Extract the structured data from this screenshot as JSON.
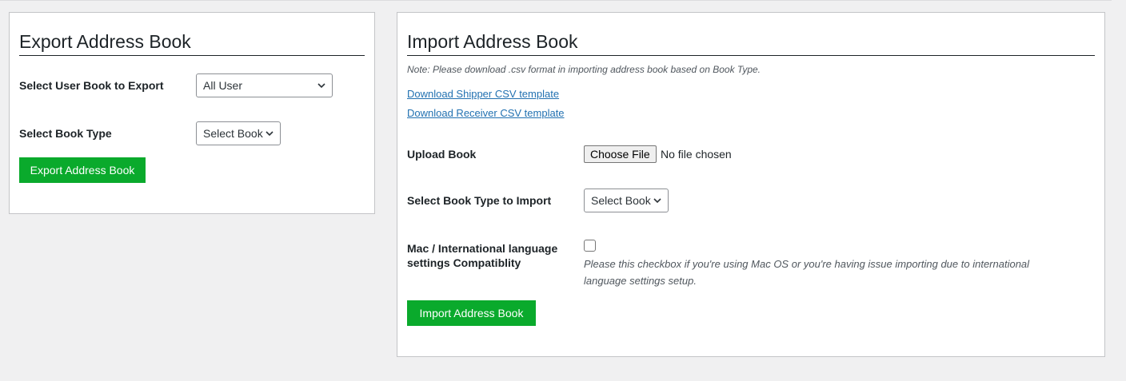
{
  "export": {
    "title": "Export Address Book",
    "user_book_label": "Select User Book to Export",
    "user_book_value": "All User",
    "book_type_label": "Select Book Type",
    "book_type_value": "Select Book",
    "button_label": "Export Address Book"
  },
  "import": {
    "title": "Import Address Book",
    "note": "Note: Please download .csv format in importing address book based on Book Type.",
    "shipper_link": "Download Shipper CSV template",
    "receiver_link": "Download Receiver CSV template",
    "upload_label": "Upload Book",
    "choose_file_label": "Choose File",
    "file_status": "No file chosen",
    "book_type_label": "Select Book Type to Import",
    "book_type_value": "Select Book",
    "compat_label_line1": "Mac / International language",
    "compat_label_line2": "settings Compatiblity",
    "compat_help_line1": "Please this checkbox if you're using Mac OS or you're having issue importing due to international",
    "compat_help_line2": "language settings setup.",
    "button_label": "Import Address Book"
  },
  "colors": {
    "button_green": "#0aaa2c",
    "link_blue": "#2271b1",
    "background": "#f0f0f1"
  },
  "icons": {
    "select_arrow": "chevron-down-icon"
  }
}
